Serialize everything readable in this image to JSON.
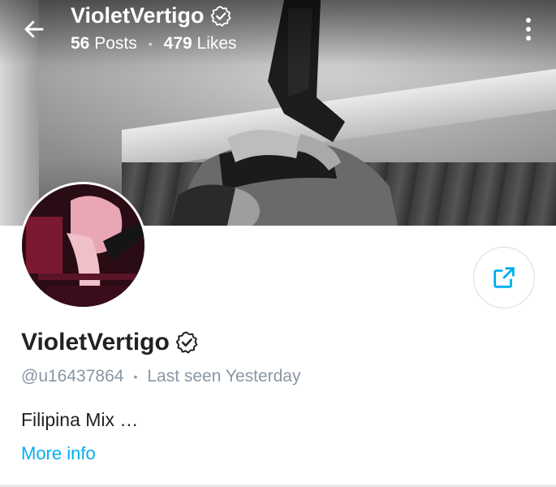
{
  "header": {
    "title": "VioletVertigo",
    "posts_count": "56",
    "posts_label": "Posts",
    "likes_count": "479",
    "likes_label": "Likes",
    "separator": "•"
  },
  "profile": {
    "name": "VioletVertigo",
    "handle": "@u16437864",
    "last_seen": "Last seen Yesterday",
    "separator": "•",
    "bio": "Filipina Mix …",
    "more_info": "More info"
  },
  "icons": {
    "back": "arrow-left-icon",
    "verified": "verified-badge-icon",
    "menu": "more-vertical-icon",
    "share": "share-icon"
  },
  "colors": {
    "accent": "#00aff0",
    "muted": "#8a96a3",
    "text": "#222222"
  }
}
